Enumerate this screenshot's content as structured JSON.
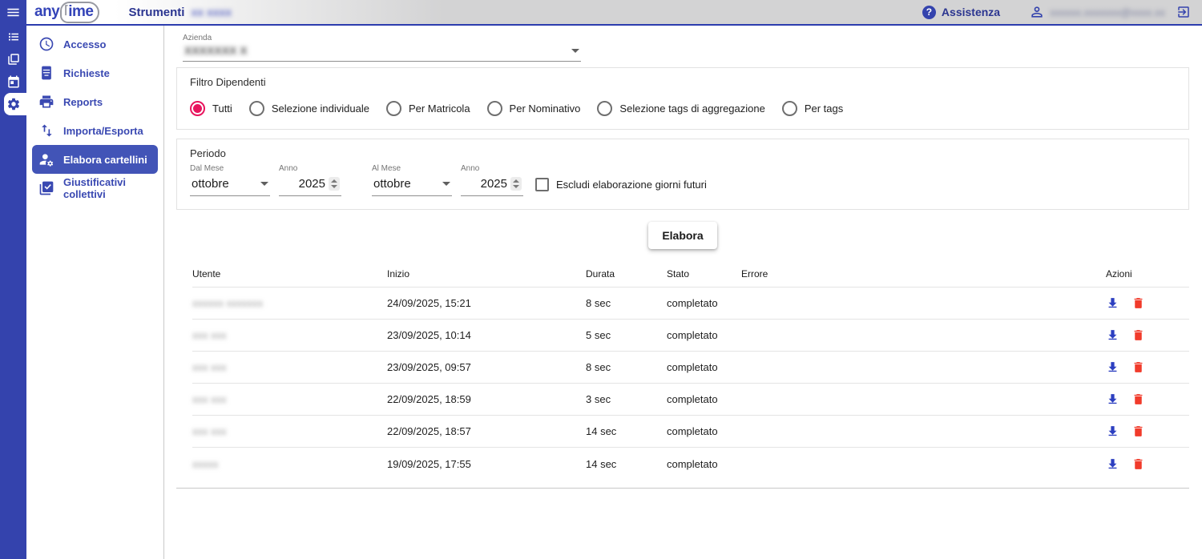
{
  "topbar": {
    "logo_any": "any",
    "logo_ime": "ime",
    "title": "Strumenti",
    "title_suffix_masked": "xx xxxx",
    "help_glyph": "?",
    "assistenza_label": "Assistenza",
    "user_email_masked": "xxxxxx.xxxxxxx@xxxx.xx"
  },
  "rail": {
    "icons": [
      "menu-icon",
      "list-icon",
      "stacked-windows-icon",
      "calendar-icon",
      "settings-icon"
    ],
    "active_icon": "settings-icon"
  },
  "sidebar": {
    "items": [
      {
        "label": "Accesso",
        "icon": "clock-icon",
        "active": false
      },
      {
        "label": "Richieste",
        "icon": "document-icon",
        "active": false
      },
      {
        "label": "Reports",
        "icon": "printer-icon",
        "active": false
      },
      {
        "label": "Importa/Esporta",
        "icon": "import-export-icon",
        "active": false
      },
      {
        "label": "Elabora cartellini",
        "icon": "manage-accounts-icon",
        "active": true
      },
      {
        "label": "Giustificativi collettivi",
        "icon": "checklist-icon",
        "active": false
      }
    ]
  },
  "azienda": {
    "label": "Azienda",
    "value_masked": "XXXXXXX X"
  },
  "filtro": {
    "title": "Filtro Dipendenti",
    "options": [
      {
        "label": "Tutti",
        "selected": true
      },
      {
        "label": "Selezione individuale",
        "selected": false
      },
      {
        "label": "Per Matricola",
        "selected": false
      },
      {
        "label": "Per Nominativo",
        "selected": false
      },
      {
        "label": "Selezione tags di aggregazione",
        "selected": false
      },
      {
        "label": "Per tags",
        "selected": false
      }
    ]
  },
  "periodo": {
    "title": "Periodo",
    "fields": [
      {
        "label": "Dal Mese",
        "value": "ottobre",
        "type": "select"
      },
      {
        "label": "Anno",
        "value": "2025",
        "type": "number"
      },
      {
        "label": "Al Mese",
        "value": "ottobre",
        "type": "select"
      },
      {
        "label": "Anno",
        "value": "2025",
        "type": "number"
      }
    ],
    "checkbox": {
      "label": "Escludi elaborazione giorni futuri",
      "checked": false
    }
  },
  "actions": {
    "elabora_label": "Elabora"
  },
  "table": {
    "columns": [
      "Utente",
      "Inizio",
      "Durata",
      "Stato",
      "Errore",
      "Azioni"
    ],
    "row_action_icons": [
      "download-icon",
      "delete-icon"
    ],
    "rows": [
      {
        "user_masked": "xxxxxx xxxxxxx",
        "inizio": "24/09/2025, 15:21",
        "durata": "8 sec",
        "stato": "completato",
        "errore": ""
      },
      {
        "user_masked": "xxx xxx",
        "inizio": "23/09/2025, 10:14",
        "durata": "5 sec",
        "stato": "completato",
        "errore": ""
      },
      {
        "user_masked": "xxx xxx",
        "inizio": "23/09/2025, 09:57",
        "durata": "8 sec",
        "stato": "completato",
        "errore": ""
      },
      {
        "user_masked": "xxx xxx",
        "inizio": "22/09/2025, 18:59",
        "durata": "3 sec",
        "stato": "completato",
        "errore": ""
      },
      {
        "user_masked": "xxx xxx",
        "inizio": "22/09/2025, 18:57",
        "durata": "14 sec",
        "stato": "completato",
        "errore": ""
      },
      {
        "user_masked": "xxxxx",
        "inizio": "19/09/2025, 17:55",
        "durata": "14 sec",
        "stato": "completato",
        "errore": ""
      }
    ]
  },
  "colors": {
    "primary_indigo": "#3443ad",
    "active_item": "#4254b7",
    "title_navy": "#2b3590",
    "radio_pink": "#e8155e",
    "download_blue": "#2c3fc0",
    "delete_red": "#f13b2b",
    "topbar_gray": "#d3d3d4"
  }
}
